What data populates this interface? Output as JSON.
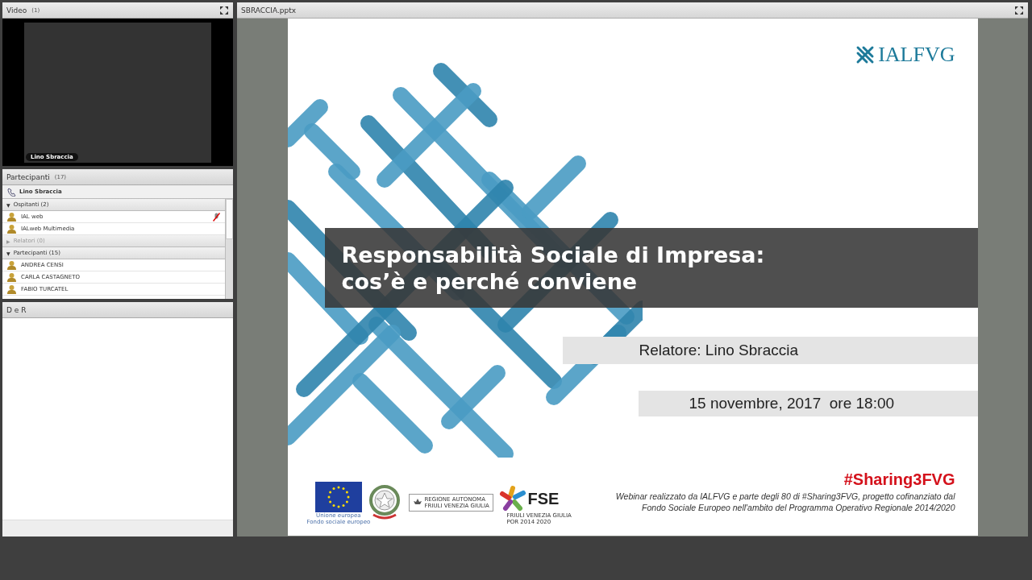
{
  "video_pod": {
    "title": "Video",
    "count": "(1)",
    "name_tag": "Lino Sbraccia"
  },
  "participants_pod": {
    "title": "Partecipanti",
    "count": "(17)",
    "host": "Lino Sbraccia",
    "groups": [
      {
        "label": "Ospitanti (2)",
        "toggle": "▼",
        "expanded": true,
        "members": [
          {
            "name": "IAL web",
            "mic_off": true
          },
          {
            "name": "IALweb Multimedia",
            "mic_off": false
          }
        ]
      },
      {
        "label": "Relatori (0)",
        "toggle": "▶",
        "expanded": false
      },
      {
        "label": "Partecipanti (15)",
        "toggle": "▼",
        "expanded": true,
        "members": [
          {
            "name": "ANDREA CENSI",
            "mic_off": false
          },
          {
            "name": "CARLA CASTAGNETO",
            "mic_off": false
          },
          {
            "name": "FABIO TURCATEL",
            "mic_off": false
          }
        ]
      }
    ]
  },
  "qa_pod": {
    "title": "D e R"
  },
  "share_pod": {
    "title": "SBRACCIA.pptx",
    "slide": {
      "logo": "IALFVG",
      "title_lines": [
        "Responsabilità Sociale di Impresa:",
        "cos’è e perché conviene"
      ],
      "speaker": "Relatore: Lino Sbraccia",
      "date": "15 novembre, 2017  ore 18:00",
      "hashtag": "#Sharing3FVG",
      "footer_lines": [
        "Webinar realizzato da IALFVG e parte degli 80 di #Sharing3FVG, progetto cofinanziato dal",
        "Fondo Sociale Europeo nell'ambito del Programma Operativo Regionale 2014/2020"
      ],
      "eu_caption": [
        "Unione europea",
        "Fondo sociale europeo"
      ],
      "region_logo": [
        "REGIONE AUTONOMA",
        "FRIULI VENEZIA GIULIA"
      ],
      "fse_logo": {
        "name": "FSE",
        "sub": "FRIULI VENEZIA GIULIA",
        "period": "POR 2014 2020"
      }
    }
  }
}
